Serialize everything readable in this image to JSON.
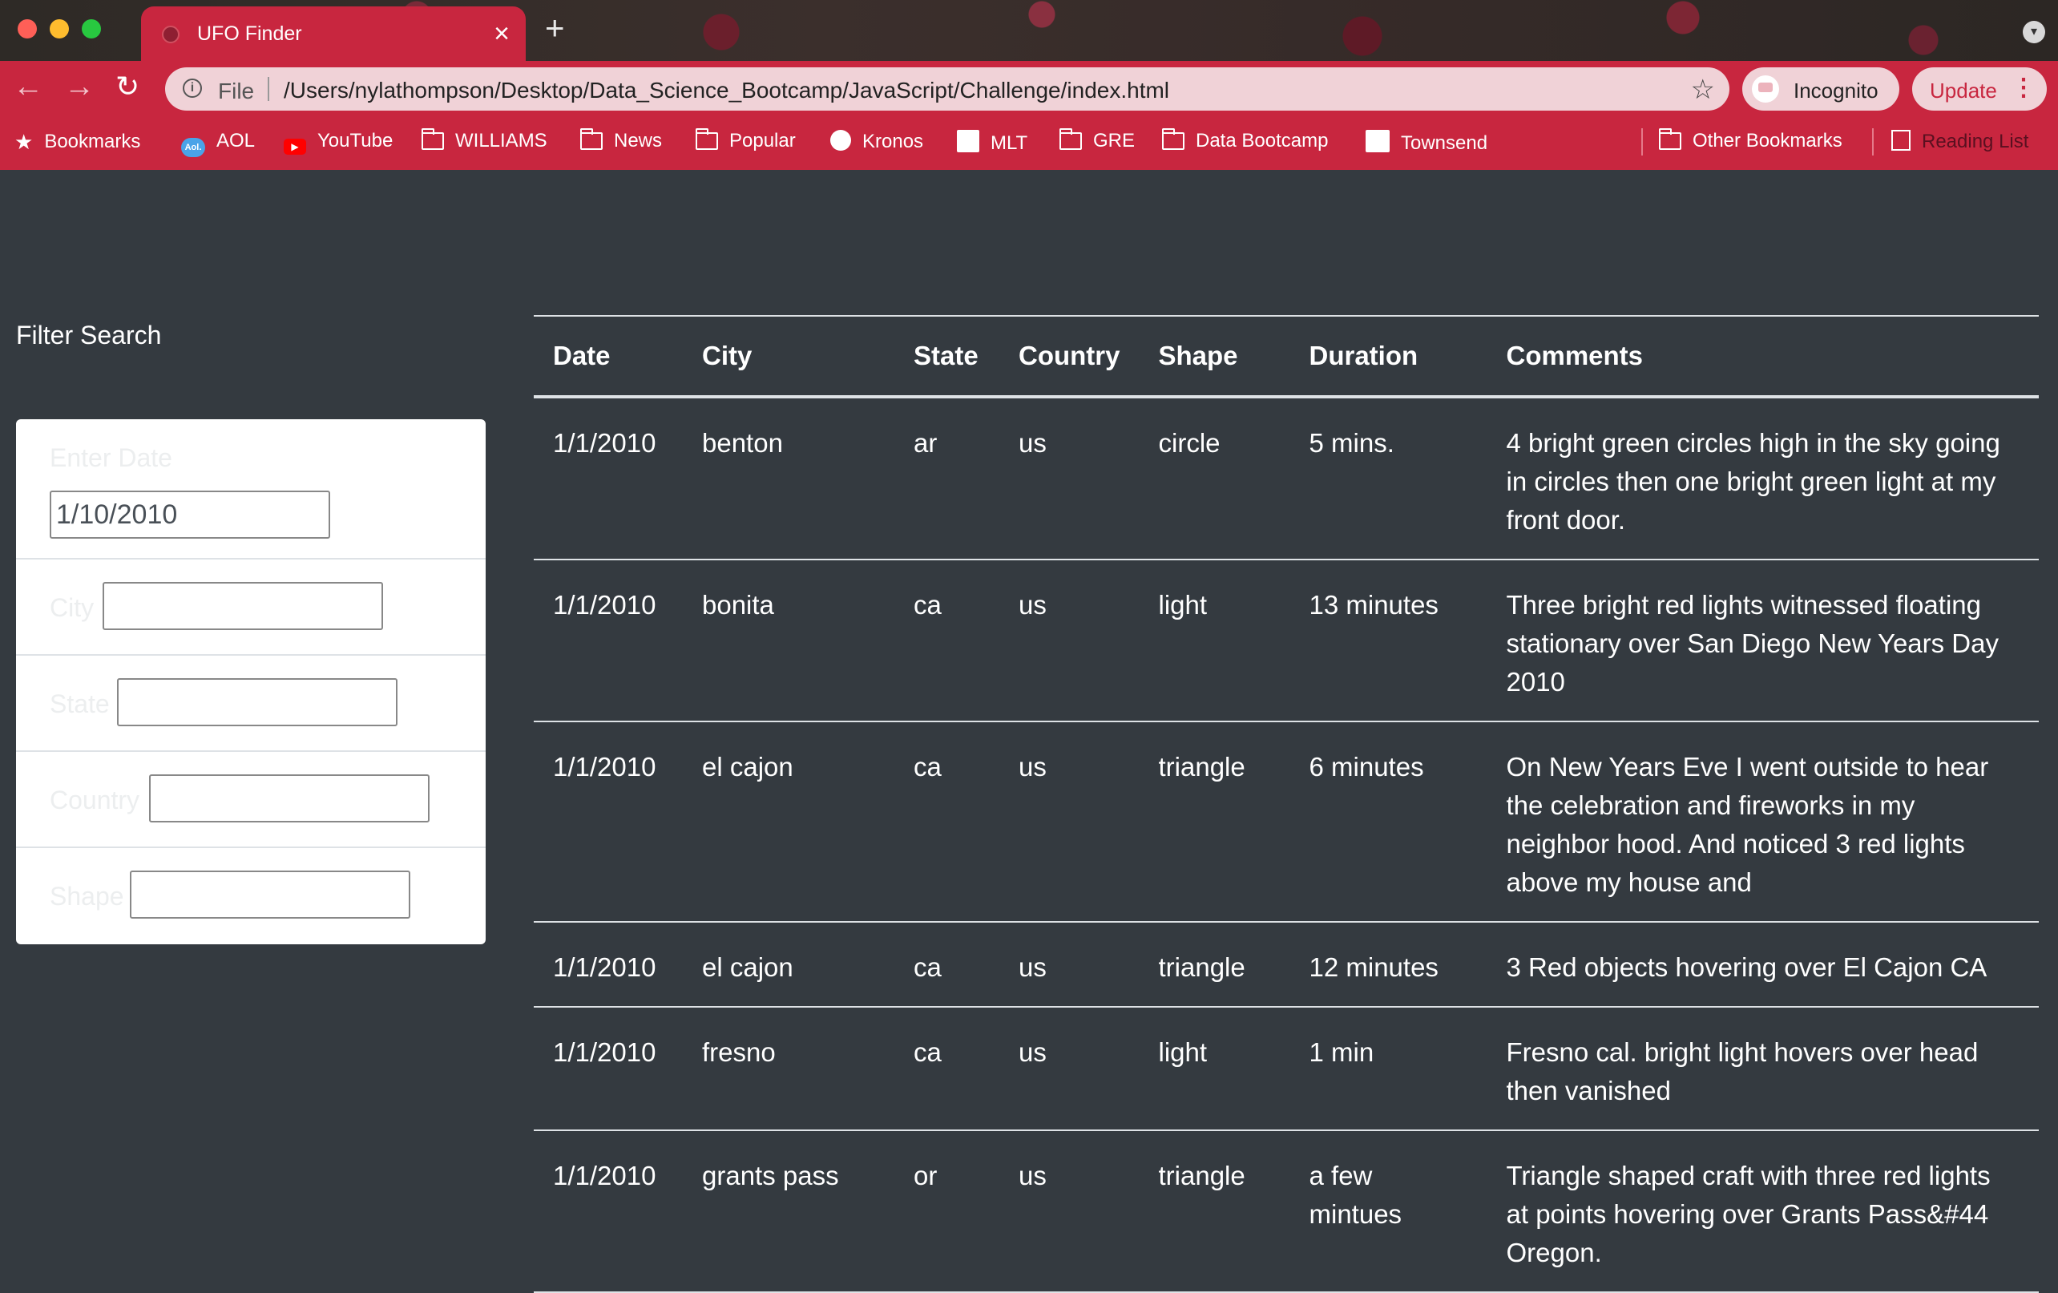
{
  "browser": {
    "tab_title": "UFO Finder",
    "url_scheme": "File",
    "url": "/Users/nylathompson/Desktop/Data_Science_Bootcamp/JavaScript/Challenge/index.html",
    "incognito_label": "Incognito",
    "update_label": "Update",
    "colors": {
      "chrome": "#c8263f",
      "omnibox": "#f0d2d7",
      "page_bg": "#343a40"
    }
  },
  "bookmarks": [
    {
      "label": "Bookmarks",
      "icon": "star-icon"
    },
    {
      "label": "AOL",
      "icon": "aol-icon"
    },
    {
      "label": "YouTube",
      "icon": "youtube-icon"
    },
    {
      "label": "WILLIAMS",
      "icon": "folder-icon"
    },
    {
      "label": "News",
      "icon": "folder-icon"
    },
    {
      "label": "Popular",
      "icon": "folder-icon"
    },
    {
      "label": "Kronos",
      "icon": "kronos-icon"
    },
    {
      "label": "MLT",
      "icon": "mlt-icon"
    },
    {
      "label": "GRE",
      "icon": "folder-icon"
    },
    {
      "label": "Data Bootcamp",
      "icon": "folder-icon"
    },
    {
      "label": "Townsend",
      "icon": "townsend-icon"
    }
  ],
  "other_bookmarks": "Other Bookmarks",
  "reading_list": "Reading List",
  "filter": {
    "title": "Filter Search",
    "fields": [
      {
        "label": "Enter Date",
        "value": "1/10/2010"
      },
      {
        "label": "City",
        "value": ""
      },
      {
        "label": "State",
        "value": ""
      },
      {
        "label": "Country",
        "value": ""
      },
      {
        "label": "Shape",
        "value": ""
      }
    ]
  },
  "table": {
    "headers": [
      "Date",
      "City",
      "State",
      "Country",
      "Shape",
      "Duration",
      "Comments"
    ],
    "rows": [
      [
        "1/1/2010",
        "benton",
        "ar",
        "us",
        "circle",
        "5 mins.",
        "4 bright green circles high in the sky going in circles then one bright green light at my front door."
      ],
      [
        "1/1/2010",
        "bonita",
        "ca",
        "us",
        "light",
        "13 minutes",
        "Three bright red lights witnessed floating stationary over San Diego New Years Day 2010"
      ],
      [
        "1/1/2010",
        "el cajon",
        "ca",
        "us",
        "triangle",
        "6 minutes",
        "On New Years Eve I went outside to hear the celebration and fireworks in my neighbor hood. And noticed 3 red lights above my house and"
      ],
      [
        "1/1/2010",
        "el cajon",
        "ca",
        "us",
        "triangle",
        "12 minutes",
        "3 Red objects hovering over El Cajon CA"
      ],
      [
        "1/1/2010",
        "fresno",
        "ca",
        "us",
        "light",
        "1 min",
        "Fresno cal. bright light hovers over head then vanished"
      ],
      [
        "1/1/2010",
        "grants pass",
        "or",
        "us",
        "triangle",
        "a few mintues",
        "Triangle shaped craft with three red lights at points hovering over Grants Pass&#44 Oregon."
      ]
    ]
  }
}
